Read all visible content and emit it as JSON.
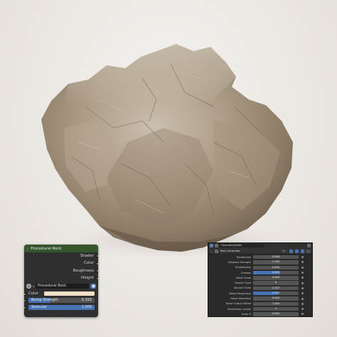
{
  "node": {
    "title": "Procedural Rock",
    "outputs": [
      "Shader",
      "Color",
      "Roughness",
      "Height"
    ],
    "material_name": "Procedural Rock",
    "color_label": "Color",
    "color_value": "#f2dfc9",
    "bump_label": "Bump Strength",
    "bump_value": "0.333",
    "bump_fraction": 0.333,
    "specular_label": "Specular",
    "specular_value": "1.000",
    "specular_fraction": 1.0,
    "header_color": "#35552c"
  },
  "modifier": {
    "object_field": "GeometryNodes",
    "name": "Rock Generator",
    "user_count": "2",
    "params": [
      {
        "label": "Randomize",
        "value": "57444",
        "fill": 0
      },
      {
        "label": "Displace Strength",
        "value": "1.183",
        "fill": 0
      },
      {
        "label": "Smoothness",
        "value": "0.000",
        "fill": 0
      },
      {
        "label": "Creases",
        "value": "0.600",
        "fill": 0.6
      },
      {
        "label": "Noise Scale",
        "value": "4.000",
        "fill": 0
      },
      {
        "label": "Voronoi Type",
        "value": "4",
        "fill": 0
      },
      {
        "label": "Voronoi Scale",
        "value": "2.357",
        "fill": 0
      },
      {
        "label": "Noise Roughness",
        "value": "0.550",
        "fill": 0.55
      },
      {
        "label": "Noise Distortion",
        "value": "0.000",
        "fill": 0
      },
      {
        "label": "Noise Output Detail",
        "value": "7.000",
        "fill": 0
      },
      {
        "label": "Subdivision Levels",
        "value": "2",
        "fill": 0
      },
      {
        "label": "Scale Z",
        "value": "0.800",
        "fill": 0
      }
    ]
  },
  "colors": {
    "accent": "#4772b3",
    "panel": "#2f2f2f",
    "background": "#ece9e6"
  }
}
